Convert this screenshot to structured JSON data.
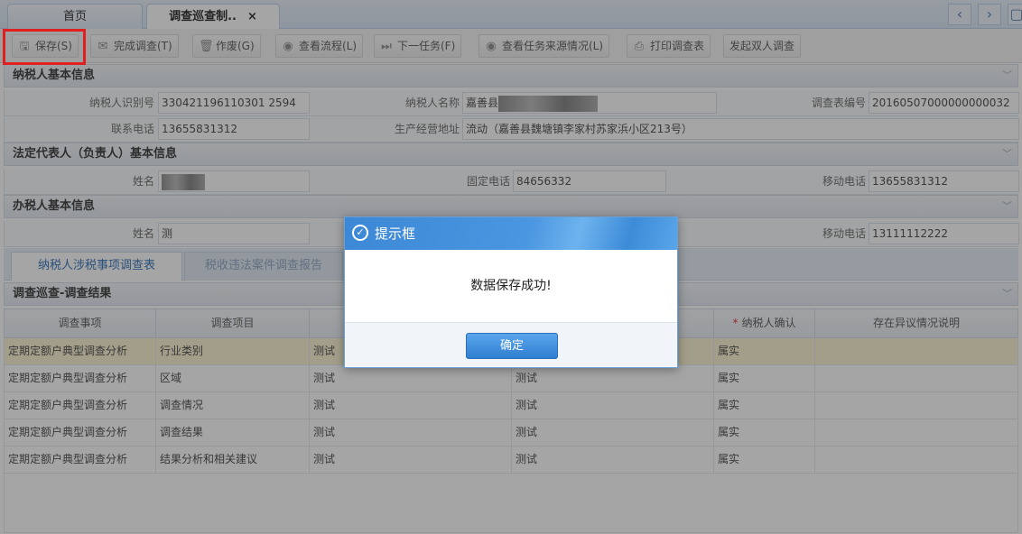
{
  "tabs": {
    "home": "首页",
    "active": "调查巡查制..",
    "close_icon": "×",
    "prev": "‹",
    "next": "›"
  },
  "toolbar": {
    "save": "保存(S)",
    "complete": "完成调查(T)",
    "void": "作废(G)",
    "view_flow": "查看流程(L)",
    "next_task": "下一任务(F)",
    "view_source": "查看任务来源情况(L)",
    "print": "打印调查表",
    "dual": "发起双人调查"
  },
  "taxpayer": {
    "title": "纳税人基本信息",
    "id_label": "纳税人识别号",
    "id_value": "330421196110301 2594",
    "name_label": "纳税人名称",
    "name_value": "嘉善县",
    "form_no_label": "调查表编号",
    "form_no_value": "20160507000000000032",
    "phone_label": "联系电话",
    "phone_value": "13655831312",
    "addr_label": "生产经营地址",
    "addr_value": "流动（嘉善县魏塘镇李家村苏家浜小区213号）"
  },
  "legal_rep": {
    "title": "法定代表人（负责人）基本信息",
    "name_label": "姓名",
    "fixed_label": "固定电话",
    "fixed_value": "84656332",
    "mobile_label": "移动电话",
    "mobile_value": "13655831312"
  },
  "tax_handler": {
    "title": "办税人基本信息",
    "name_label": "姓名",
    "name_value": "测",
    "mobile_label": "移动电话",
    "mobile_value": "13111112222"
  },
  "subtabs": {
    "active": "纳税人涉税事项调查表",
    "inactive": "税收违法案件调查报告"
  },
  "result": {
    "title": "调查巡查-调查结果",
    "headers": [
      "调查事项",
      "调查项目",
      "",
      "",
      "纳税人确认",
      "存在异议情况说明"
    ],
    "rows": [
      [
        "定期定额户典型调查分析",
        "行业类别",
        "测试",
        "",
        "属实",
        ""
      ],
      [
        "定期定额户典型调查分析",
        "区域",
        "测试",
        "测试",
        "属实",
        ""
      ],
      [
        "定期定额户典型调查分析",
        "调查情况",
        "测试",
        "测试",
        "属实",
        ""
      ],
      [
        "定期定额户典型调查分析",
        "调查结果",
        "测试",
        "测试",
        "属实",
        ""
      ],
      [
        "定期定额户典型调查分析",
        "结果分析和相关建议",
        "测试",
        "测试",
        "属实",
        ""
      ]
    ]
  },
  "dialog": {
    "title": "提示框",
    "message": "数据保存成功!",
    "ok": "确定"
  }
}
